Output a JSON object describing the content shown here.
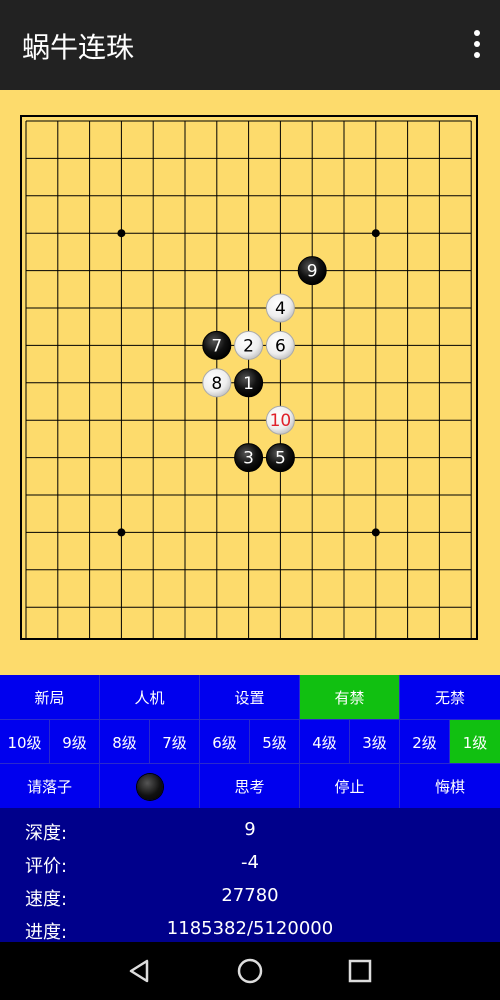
{
  "app": {
    "title": "蜗牛连珠"
  },
  "icons": {
    "menu": "more-vert-icon",
    "back": "nav-back-icon",
    "home": "nav-home-icon",
    "recents": "nav-recents-icon"
  },
  "colors": {
    "board": "#fddb6c",
    "controls": "#0000ee",
    "active": "#11c011",
    "info": "#00008b",
    "last_move_number": "#e0202a"
  },
  "board": {
    "size": 15,
    "star_points": [
      [
        3,
        3
      ],
      [
        11,
        3
      ],
      [
        3,
        11
      ],
      [
        11,
        11
      ]
    ],
    "stones": [
      {
        "num": "1",
        "color": "black",
        "col": 7,
        "row": 7
      },
      {
        "num": "2",
        "color": "white",
        "col": 7,
        "row": 6
      },
      {
        "num": "3",
        "color": "black",
        "col": 7,
        "row": 9
      },
      {
        "num": "4",
        "color": "white",
        "col": 8,
        "row": 5
      },
      {
        "num": "5",
        "color": "black",
        "col": 8,
        "row": 9
      },
      {
        "num": "6",
        "color": "white",
        "col": 8,
        "row": 6
      },
      {
        "num": "7",
        "color": "black",
        "col": 6,
        "row": 6
      },
      {
        "num": "8",
        "color": "white",
        "col": 6,
        "row": 7
      },
      {
        "num": "9",
        "color": "black",
        "col": 9,
        "row": 4
      },
      {
        "num": "10",
        "color": "white",
        "col": 8,
        "row": 8,
        "last": true
      }
    ]
  },
  "controls": {
    "row1": [
      {
        "label": "新局",
        "active": false
      },
      {
        "label": "人机",
        "active": false
      },
      {
        "label": "设置",
        "active": false
      },
      {
        "label": "有禁",
        "active": true
      },
      {
        "label": "无禁",
        "active": false
      }
    ],
    "levels": [
      {
        "label": "10级",
        "active": false
      },
      {
        "label": "9级",
        "active": false
      },
      {
        "label": "8级",
        "active": false
      },
      {
        "label": "7级",
        "active": false
      },
      {
        "label": "6级",
        "active": false
      },
      {
        "label": "5级",
        "active": false
      },
      {
        "label": "4级",
        "active": false
      },
      {
        "label": "3级",
        "active": false
      },
      {
        "label": "2级",
        "active": false
      },
      {
        "label": "1级",
        "active": true
      }
    ],
    "status": "请落子",
    "current_stone": "black",
    "think": "思考",
    "stop": "停止",
    "undo": "悔棋"
  },
  "info": [
    {
      "label": "深度:",
      "value": "9"
    },
    {
      "label": "评价:",
      "value": "-4"
    },
    {
      "label": "速度:",
      "value": "27780"
    },
    {
      "label": "进度:",
      "value": "1185382/5120000"
    }
  ]
}
